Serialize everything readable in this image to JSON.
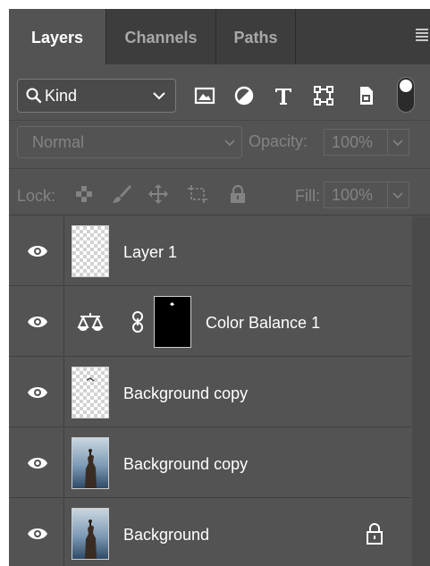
{
  "tabs": [
    {
      "label": "Layers",
      "active": true
    },
    {
      "label": "Channels",
      "active": false
    },
    {
      "label": "Paths",
      "active": false
    }
  ],
  "filter": {
    "kind_label": "Kind",
    "icons": [
      "image-filter-icon",
      "adjustment-filter-icon",
      "type-filter-icon",
      "shape-filter-icon",
      "smart-object-filter-icon"
    ]
  },
  "blend": {
    "mode": "Normal",
    "opacity_label": "Opacity:",
    "opacity_value": "100%"
  },
  "lock": {
    "label": "Lock:",
    "fill_label": "Fill:",
    "fill_value": "100%"
  },
  "layers": [
    {
      "name": "Layer 1",
      "visible": true,
      "type": "pixel-transparent"
    },
    {
      "name": "Color Balance 1",
      "visible": true,
      "type": "adjustment-color-balance"
    },
    {
      "name": "Background copy",
      "visible": true,
      "type": "pixel-transparent"
    },
    {
      "name": "Background copy",
      "visible": true,
      "type": "photo"
    },
    {
      "name": "Background",
      "visible": true,
      "type": "photo",
      "locked": true
    }
  ],
  "colors": {
    "panel_bg": "#535353",
    "tab_bar_bg": "#3d3d3d",
    "text_primary": "#ffffff",
    "text_disabled": "#838383"
  }
}
